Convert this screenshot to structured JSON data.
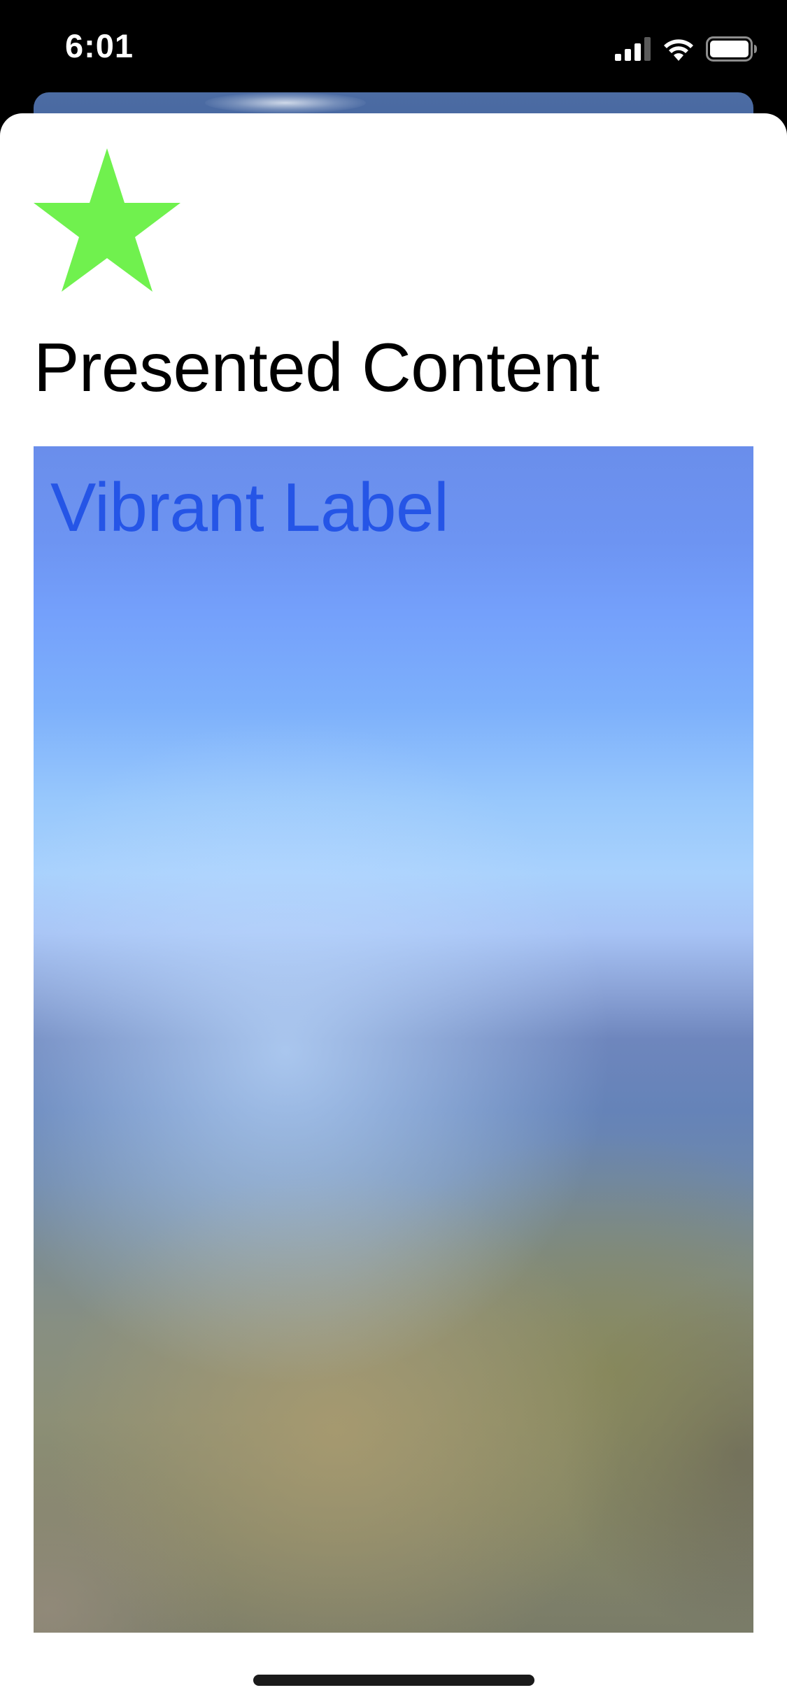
{
  "status_bar": {
    "time": "6:01",
    "icons": [
      "signal-icon",
      "wifi-icon",
      "battery-icon"
    ]
  },
  "sheet": {
    "icon": "star-icon",
    "icon_color": "#70f14e",
    "title": "Presented Content",
    "vibrancy_panel": {
      "label": "Vibrant Label",
      "label_color": "#1e4fe6"
    }
  },
  "colors": {
    "status_bar_background": "#000000",
    "sheet_background": "#ffffff",
    "underlying_card": "#4c6ca3"
  }
}
